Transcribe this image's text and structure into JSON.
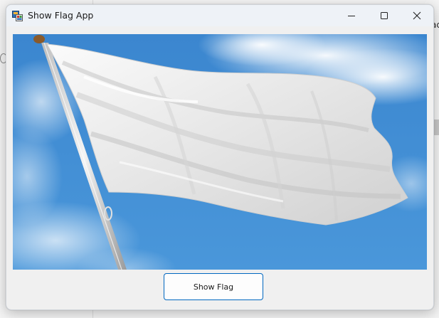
{
  "window": {
    "title": "Show Flag App",
    "app_icon": "winforms-app-icon"
  },
  "caption_buttons": {
    "minimize_icon": "minimize-icon",
    "maximize_icon": "maximize-icon",
    "close_icon": "close-icon"
  },
  "picture": {
    "subject": "flag-image",
    "colors": {
      "sky": "#3f8ed4",
      "flag": "#eeeeee",
      "pole": "#d9d9d9",
      "finial": "#8a5a2b"
    }
  },
  "buttons": {
    "show_flag_label": "Show Flag"
  },
  "background": {
    "top_text": "",
    "right_text": "ac",
    "bottom_text": ""
  }
}
